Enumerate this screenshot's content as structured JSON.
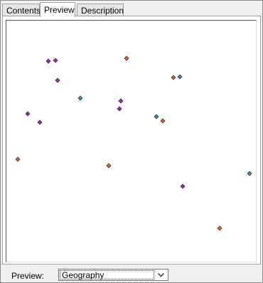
{
  "tabs": [
    {
      "label": "Contents",
      "active": false
    },
    {
      "label": "Preview",
      "active": true
    },
    {
      "label": "Description",
      "active": false
    }
  ],
  "preview": {
    "view_label": "Preview:",
    "selected_view": "Geography",
    "features": [
      {
        "color": "#9d2fa8"
      },
      {
        "color": "#9d2fa8"
      },
      {
        "color": "#e0602a"
      },
      {
        "color": "#9d2fa8"
      },
      {
        "color": "#e0602a"
      },
      {
        "color": "#3b8fb0"
      },
      {
        "color": "#3b8fb0"
      },
      {
        "color": "#9d2fa8"
      },
      {
        "color": "#9d2fa8"
      },
      {
        "color": "#9d2fa8"
      },
      {
        "color": "#9d2fa8"
      },
      {
        "color": "#3b8fb0"
      },
      {
        "color": "#e0602a"
      },
      {
        "color": "#e0602a"
      },
      {
        "color": "#e0602a"
      },
      {
        "color": "#3b8fb0"
      },
      {
        "color": "#9d2fa8"
      },
      {
        "color": "#e0602a"
      }
    ]
  },
  "colors": {
    "purple": "#9d2fa8",
    "orange": "#e0602a",
    "teal": "#3b8fb0"
  }
}
